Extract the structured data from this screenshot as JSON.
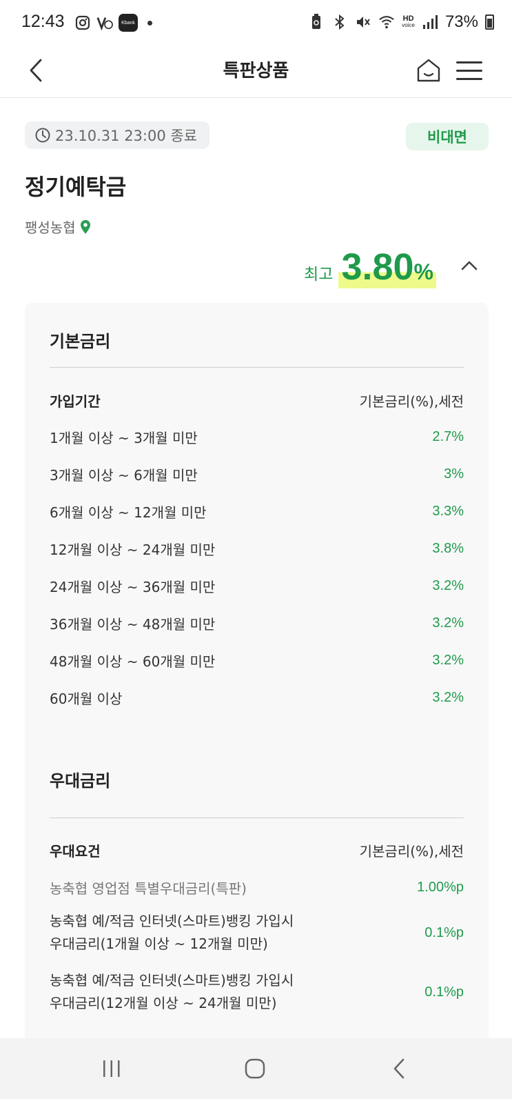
{
  "status_bar": {
    "time": "12:43",
    "kbank_label": "Kbank",
    "hd_top": "HD",
    "hd_bottom": "voice",
    "battery_pct": "73%"
  },
  "header": {
    "title": "특판상품"
  },
  "product": {
    "deadline": "23.10.31 23:00 종료",
    "channel_badge": "비대면",
    "name": "정기예탁금",
    "branch": "팽성농협",
    "max_rate_label": "최고",
    "max_rate_value": "3.80",
    "max_rate_unit": "%"
  },
  "base_rate": {
    "title": "기본금리",
    "col_period": "가입기간",
    "col_rate": "기본금리(%),세전",
    "rows": [
      {
        "period": "1개월 이상 ~ 3개월 미만",
        "rate": "2.7%"
      },
      {
        "period": "3개월 이상 ~ 6개월 미만",
        "rate": "3%"
      },
      {
        "period": "6개월 이상 ~ 12개월 미만",
        "rate": "3.3%"
      },
      {
        "period": "12개월 이상 ~ 24개월 미만",
        "rate": "3.8%"
      },
      {
        "period": "24개월 이상 ~ 36개월 미만",
        "rate": "3.2%"
      },
      {
        "period": "36개월 이상 ~ 48개월 미만",
        "rate": "3.2%"
      },
      {
        "period": "48개월 이상 ~ 60개월 미만",
        "rate": "3.2%"
      },
      {
        "period": "60개월 이상",
        "rate": "3.2%"
      }
    ]
  },
  "bonus_rate": {
    "title": "우대금리",
    "col_condition": "우대요건",
    "col_rate": "기본금리(%),세전",
    "rows": [
      {
        "line1": "농축협 영업점 특별우대금리(특판)",
        "line2": "",
        "rate": "1.00%p"
      },
      {
        "line1": "농축협 예/적금 인터넷(스마트)뱅킹 가입시",
        "line2": "우대금리(1개월 이상 ~ 12개월 미만)",
        "rate": "0.1%p"
      },
      {
        "line1": "농축협 예/적금 인터넷(스마트)뱅킹 가입시",
        "line2": "우대금리(12개월 이상 ~ 24개월 미만)",
        "rate": "0.1%p"
      }
    ]
  },
  "colors": {
    "accent_green": "#1f9a4a",
    "badge_bg": "#e7f6ec",
    "highlight_yellow": "#eefb8c",
    "card_bg": "#f8f8f9"
  },
  "icons": [
    "instagram-icon",
    "v-app-icon",
    "kbank-icon",
    "battery-saver-icon",
    "bluetooth-icon",
    "mute-icon",
    "wifi-icon",
    "signal-icon",
    "battery-icon",
    "back-arrow-icon",
    "home-icon",
    "hamburger-menu-icon",
    "clock-icon",
    "location-pin-icon",
    "chevron-up-icon",
    "recent-apps-icon",
    "home-circle-icon",
    "nav-back-icon"
  ]
}
